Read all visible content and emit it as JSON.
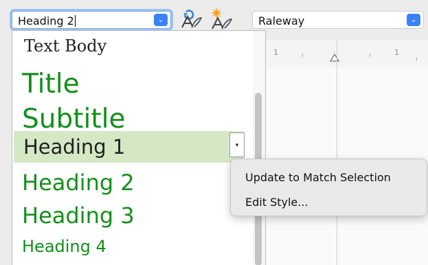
{
  "toolbar": {
    "style_value": "Heading 2",
    "font_value": "Raleway",
    "style_dropdown_glyph": "⌄",
    "font_dropdown_glyph": "⌄",
    "update_icon": "update-style-icon",
    "new_icon": "new-style-icon"
  },
  "ruler": {
    "numbers": [
      "1",
      "1"
    ]
  },
  "style_list": {
    "items": [
      {
        "label": "Text Body"
      },
      {
        "label": "Title"
      },
      {
        "label": "Subtitle"
      },
      {
        "label": "Heading 1",
        "highlighted": true
      },
      {
        "label": "Heading 2"
      },
      {
        "label": "Heading 3"
      },
      {
        "label": "Heading 4"
      }
    ],
    "item_menu_glyph": "▾"
  },
  "context_menu": {
    "items": [
      {
        "label": "Update to Match Selection"
      },
      {
        "label": "Edit Style..."
      }
    ]
  },
  "colors": {
    "accent": "#3a82f7",
    "style_green": "#148f1b",
    "highlight": "#d4e8c4"
  }
}
